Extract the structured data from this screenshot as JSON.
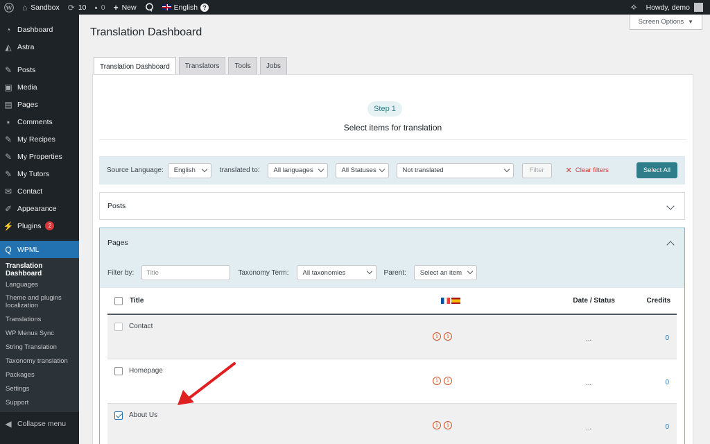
{
  "adminbar": {
    "site_name": "Sandbox",
    "updates_count": "10",
    "comments_count": "0",
    "new_label": "New",
    "language": "English",
    "greeting": "Howdy, demo"
  },
  "sidebar": {
    "items": [
      {
        "label": "Dashboard",
        "icon": "dashboard-icon"
      },
      {
        "label": "Astra",
        "icon": "astra-icon"
      },
      {
        "label": "Posts",
        "icon": "pin-icon"
      },
      {
        "label": "Media",
        "icon": "media-icon"
      },
      {
        "label": "Pages",
        "icon": "pages-icon"
      },
      {
        "label": "Comments",
        "icon": "comment-icon"
      },
      {
        "label": "My Recipes",
        "icon": "pin-icon"
      },
      {
        "label": "My Properties",
        "icon": "pin-icon"
      },
      {
        "label": "My Tutors",
        "icon": "pin-icon"
      },
      {
        "label": "Contact",
        "icon": "mail-icon"
      },
      {
        "label": "Appearance",
        "icon": "brush-icon"
      },
      {
        "label": "Plugins",
        "icon": "plug-icon",
        "badge": "2"
      },
      {
        "label": "WPML",
        "icon": "wpml-icon"
      }
    ],
    "submenu": [
      "Translation Dashboard",
      "Languages",
      "Theme and plugins localization",
      "Translations",
      "WP Menus Sync",
      "String Translation",
      "Taxonomy translation",
      "Packages",
      "Settings",
      "Support"
    ],
    "collapse_label": "Collapse menu"
  },
  "main": {
    "page_title": "Translation Dashboard",
    "screen_options": "Screen Options",
    "tabs": [
      "Translation Dashboard",
      "Translators",
      "Tools",
      "Jobs"
    ],
    "step_label": "Step 1",
    "step_subtitle": "Select items for translation",
    "filters": {
      "source_language_label": "Source Language:",
      "source_language_value": "English",
      "translated_to_label": "translated to:",
      "languages_value": "All languages",
      "statuses_value": "All Statuses",
      "translation_value": "Not translated",
      "filter_button": "Filter",
      "clear_filters": "Clear filters",
      "select_all": "Select All"
    },
    "posts_section": "Posts",
    "pages_section": {
      "title": "Pages",
      "filter_by_label": "Filter by:",
      "title_placeholder": "Title",
      "taxonomy_label": "Taxonomy Term:",
      "taxonomy_value": "All taxonomies",
      "parent_label": "Parent:",
      "parent_value": "Select an item"
    },
    "table": {
      "headers": {
        "title": "Title",
        "date_status": "Date / Status",
        "credits": "Credits"
      },
      "rows": [
        {
          "title": "Contact",
          "date": "...",
          "credits": "0",
          "checked": false
        },
        {
          "title": "Homepage",
          "date": "...",
          "credits": "0",
          "checked": false
        },
        {
          "title": "About Us",
          "date": "...",
          "credits": "0",
          "checked": true
        }
      ]
    }
  },
  "colors": {
    "admin_dark": "#1d2327",
    "accent_blue": "#2271b1",
    "wpml_teal": "#2f7d8a",
    "arrow_red": "#e02020"
  }
}
